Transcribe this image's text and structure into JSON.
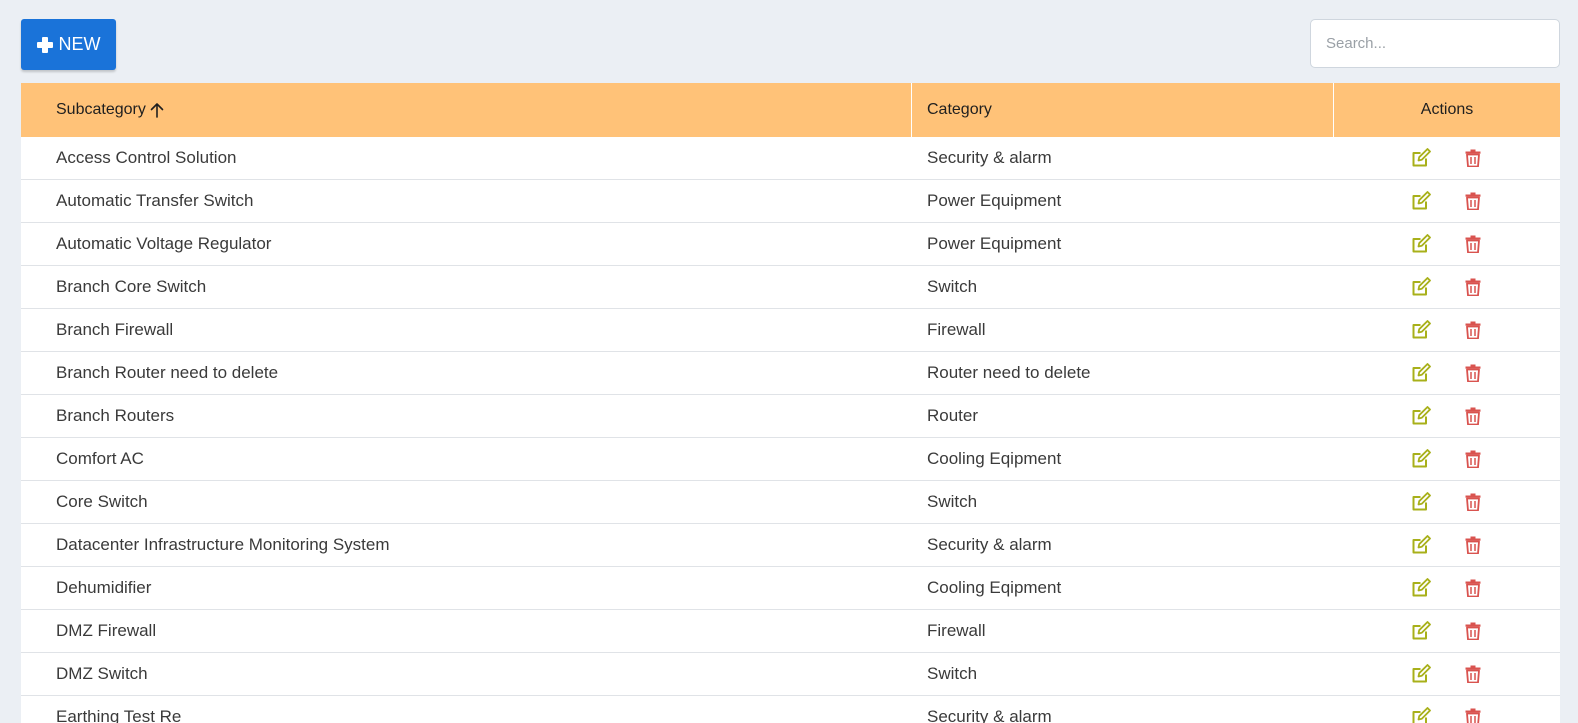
{
  "toolbar": {
    "new_label": "NEW",
    "search_placeholder": "Search..."
  },
  "colors": {
    "primary": "#1a73d9",
    "header_bg": "#ffc278",
    "edit_icon": "#a8b01a",
    "delete_icon": "#d9534f",
    "page_bg": "#ebeff4"
  },
  "table": {
    "columns": {
      "subcategory": "Subcategory",
      "category": "Category",
      "actions": "Actions"
    },
    "sort": {
      "column": "subcategory",
      "direction": "ascending"
    },
    "rows": [
      {
        "subcategory": "Access Control Solution",
        "category": "Security & alarm"
      },
      {
        "subcategory": "Automatic Transfer Switch",
        "category": "Power Equipment"
      },
      {
        "subcategory": "Automatic Voltage Regulator",
        "category": "Power Equipment"
      },
      {
        "subcategory": "Branch Core Switch",
        "category": "Switch"
      },
      {
        "subcategory": "Branch Firewall",
        "category": "Firewall"
      },
      {
        "subcategory": "Branch Router need to delete",
        "category": "Router need to delete"
      },
      {
        "subcategory": "Branch Routers",
        "category": "Router"
      },
      {
        "subcategory": "Comfort AC",
        "category": "Cooling Eqipment"
      },
      {
        "subcategory": "Core Switch",
        "category": "Switch"
      },
      {
        "subcategory": "Datacenter Infrastructure Monitoring System",
        "category": "Security & alarm"
      },
      {
        "subcategory": "Dehumidifier",
        "category": "Cooling Eqipment"
      },
      {
        "subcategory": "DMZ Firewall",
        "category": "Firewall"
      },
      {
        "subcategory": "DMZ Switch",
        "category": "Switch"
      },
      {
        "subcategory": "Earthing Test Re",
        "category": "Security & alarm"
      }
    ]
  }
}
